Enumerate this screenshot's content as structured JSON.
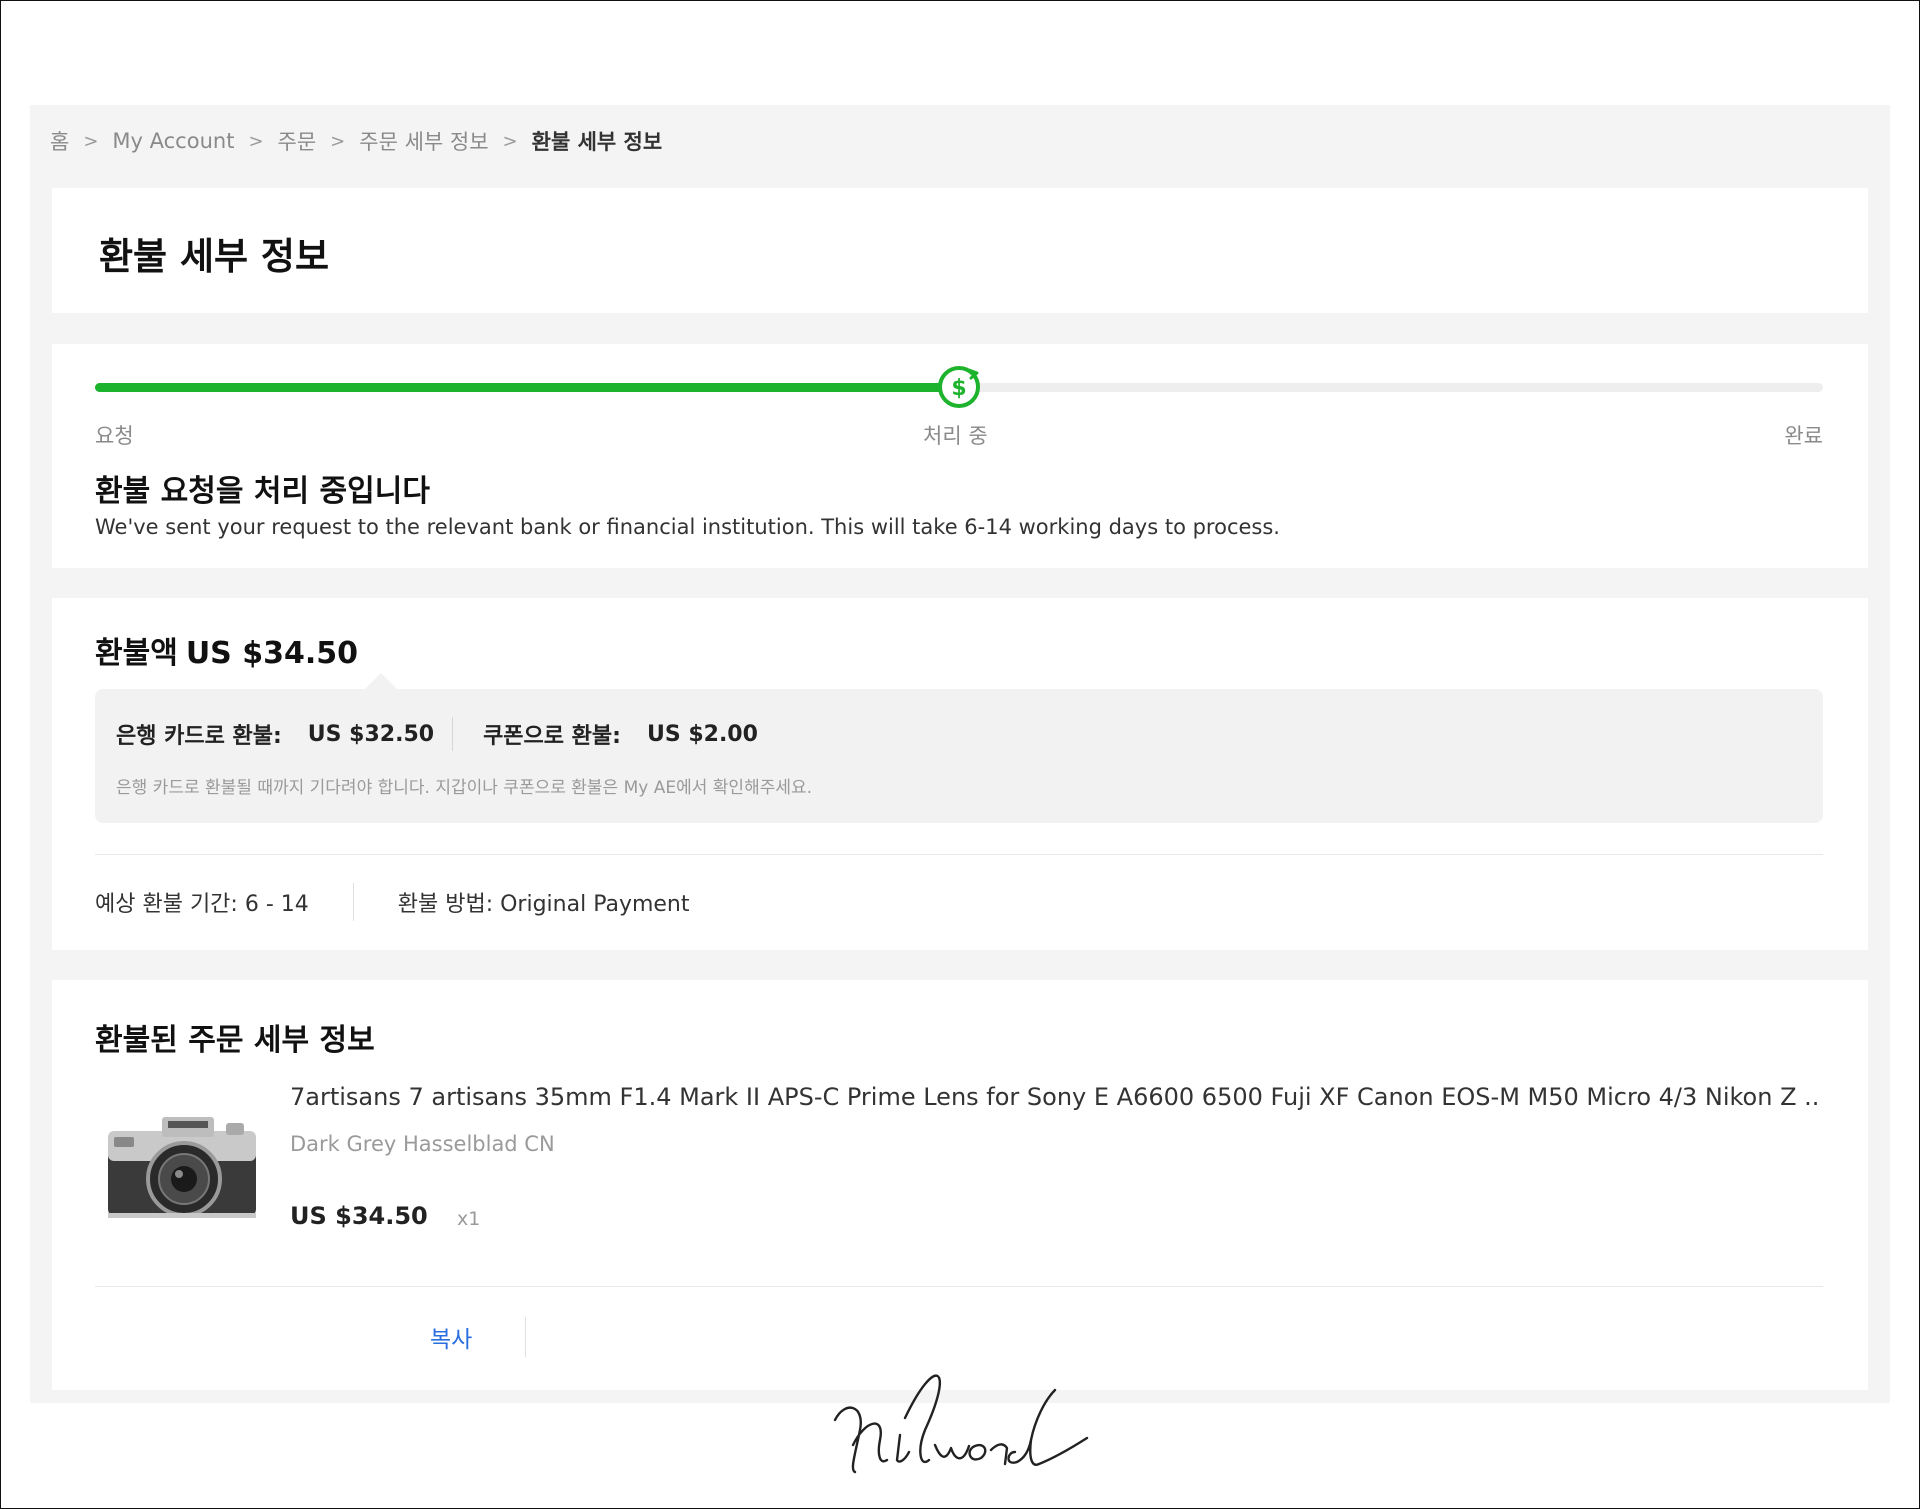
{
  "breadcrumb": {
    "items": [
      "홈",
      "My Account",
      "주문",
      "주문 세부 정보"
    ],
    "separator": ">",
    "current": "환불 세부 정보"
  },
  "page": {
    "title": "환불 세부 정보"
  },
  "progress": {
    "steps": [
      "요청",
      "처리 중",
      "완료"
    ],
    "current_step": 2,
    "current_step_icon": "refund-dollar-icon",
    "fraction_complete": 0.5,
    "heading": "환불 요청을 처리 중입니다",
    "description": "We've sent your request to the relevant bank or financial institution. This will take 6-14 working days to process.",
    "accent_color": "#1db32d"
  },
  "refund": {
    "title_label": "환불액",
    "total": "US $34.50",
    "bank_card_label": "은행 카드로 환불:",
    "bank_card_amount": "US $32.50",
    "coupon_label": "쿠폰으로 환불:",
    "coupon_amount": "US $2.00",
    "note": "은행 카드로 환불될 때까지 기다려야 합니다. 지갑이나 쿠폰으로 환불은 My AE에서 확인해주세요.",
    "estimated_period": "예상 환불 기간: 6 - 14",
    "method": "환불 방법: Original Payment"
  },
  "order": {
    "title": "환불된 주문 세부 정보",
    "product_title": "7artisans 7 artisans 35mm F1.4 Mark II APS-C Prime Lens for Sony E A6600 6500 Fuji XF Canon EOS-M M50 Micro 4/3 Nikon Z ...",
    "variant": "Dark Grey Hasselblad CN",
    "price": "US $34.50",
    "quantity": "x1",
    "thumbnail_icon": "camera-icon",
    "copy_label": "복사",
    "link_color": "#2a6fe0"
  },
  "signature": {
    "text": "hiword"
  }
}
